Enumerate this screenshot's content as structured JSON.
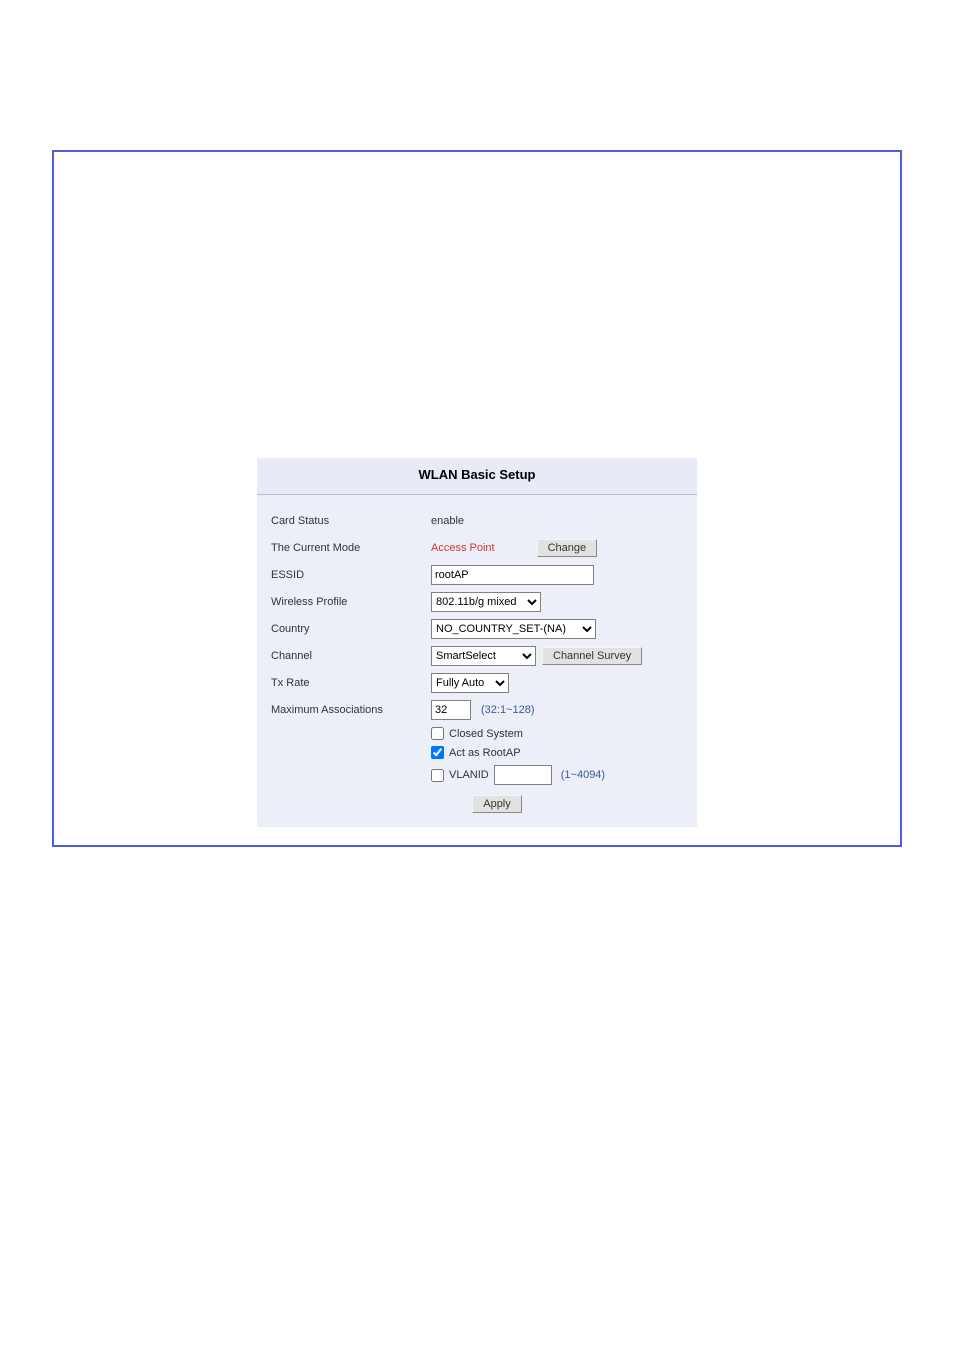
{
  "header": {
    "title": "WLAN Basic Setup"
  },
  "form": {
    "card_status": {
      "label": "Card Status",
      "value": "enable"
    },
    "current_mode": {
      "label": "The Current Mode",
      "value": "Access Point",
      "change_button": "Change"
    },
    "essid": {
      "label": "ESSID",
      "value": "rootAP"
    },
    "wireless_profile": {
      "label": "Wireless Profile",
      "value": "802.11b/g mixed"
    },
    "country": {
      "label": "Country",
      "value": "NO_COUNTRY_SET-(NA)"
    },
    "channel": {
      "label": "Channel",
      "value": "SmartSelect",
      "survey_button": "Channel Survey"
    },
    "tx_rate": {
      "label": "Tx Rate",
      "value": "Fully Auto"
    },
    "max_assoc": {
      "label": "Maximum Associations",
      "value": "32",
      "range": "(32:1~128)"
    },
    "closed_system": {
      "label": "Closed System",
      "checked": false
    },
    "act_as_rootap": {
      "label": "Act as RootAP",
      "checked": true
    },
    "vlanid": {
      "label": "VLANID",
      "checked": false,
      "value": "",
      "range": "(1~4094)"
    },
    "apply": "Apply"
  }
}
